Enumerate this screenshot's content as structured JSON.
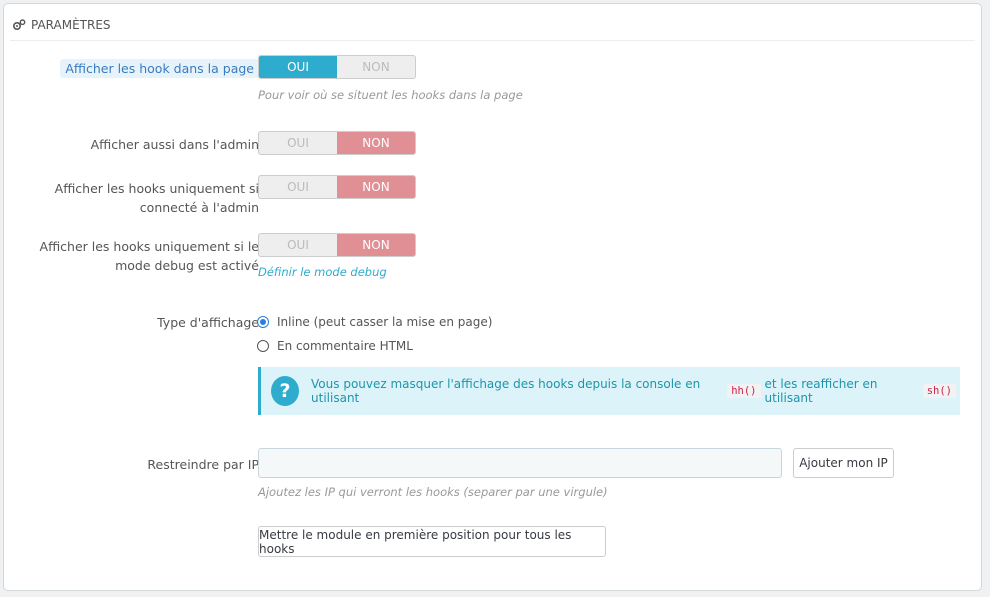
{
  "panel": {
    "title": "PARAMÈTRES",
    "icon": "gears-icon"
  },
  "fields": {
    "show_hooks": {
      "label": "Afficher les hook dans la page",
      "on": "OUI",
      "off": "NON",
      "value": "on",
      "help": "Pour voir où se situent les hooks dans la page"
    },
    "show_admin": {
      "label": "Afficher aussi dans l'admin",
      "on": "OUI",
      "off": "NON",
      "value": "off"
    },
    "only_admin": {
      "label_line1": "Afficher les hooks uniquement si",
      "label_line2": "connecté à l'admin",
      "on": "OUI",
      "off": "NON",
      "value": "off"
    },
    "only_debug": {
      "label_line1": "Afficher les hooks uniquement si le",
      "label_line2": "mode debug est activé",
      "on": "OUI",
      "off": "NON",
      "value": "off",
      "help_link": "Définir le mode debug"
    },
    "display_type": {
      "label": "Type d'affichage",
      "options": [
        "Inline (peut casser la mise en page)",
        "En commentaire HTML"
      ],
      "selected": 0
    },
    "alert": {
      "text_before": "Vous pouvez masquer l'affichage des hooks depuis la console en utilisant",
      "code1": "hh()",
      "text_middle": "et les reafficher en utilisant",
      "code2": "sh()"
    },
    "restrict_ip": {
      "label": "Restreindre par IP",
      "value": "",
      "button": "Ajouter mon IP",
      "help": "Ajoutez les IP qui verront les hooks (separer par une virgule)"
    },
    "first_position_button": "Mettre le module en première position pour tous les hooks"
  }
}
